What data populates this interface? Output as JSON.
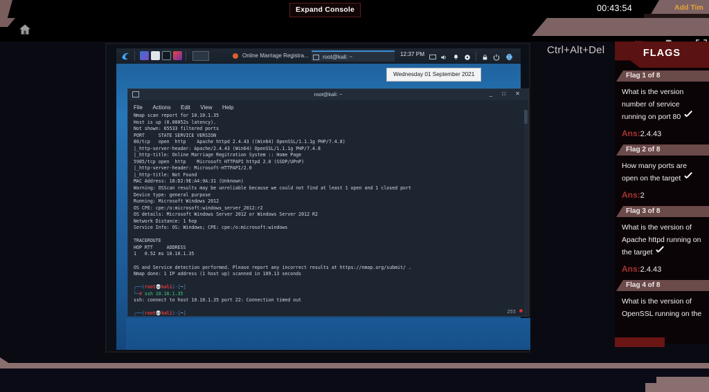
{
  "platform": {
    "expand_console_label": "Expand Console",
    "timer": "00:43:54",
    "add_time_label": "Add Tim",
    "ctrl_alt_del_label": "Ctrl+Alt+Del",
    "home_icon": "home-icon",
    "flag_icon": "red-flag-icon",
    "doc_icon": "document-icon",
    "fullscreen_icon": "fullscreen-icon",
    "accent_red": "#6b1515",
    "accent_orange": "#e8a33d",
    "chrome_brown": "#7d6363"
  },
  "flags_panel": {
    "title": "FLAGS",
    "answer_label": "Ans:",
    "flags": [
      {
        "header": "Flag 1 of 8",
        "question_lines": [
          "What is the version",
          "number of service",
          "running on port 80"
        ],
        "solved": true,
        "answer": "2.4.43"
      },
      {
        "header": "Flag 2 of 8",
        "question_lines": [
          "How many ports are",
          "open on the target"
        ],
        "solved": true,
        "answer": "2"
      },
      {
        "header": "Flag 3 of 8",
        "question_lines": [
          "What is the version of",
          "Apache httpd running on",
          "the target"
        ],
        "solved": true,
        "answer": "2.4.43"
      },
      {
        "header": "Flag 4 of 8",
        "question_lines": [
          "What is the version of",
          "OpenSSL running on the"
        ],
        "solved": false,
        "answer": ""
      }
    ]
  },
  "kali": {
    "taskbar": {
      "launcher_icon": "kali-dragon-icon",
      "quick_icons": [
        "terminal-icon",
        "files-icon",
        "console-icon",
        "firefox-icon"
      ],
      "active_app_icon": "terminal-icon",
      "windows": [
        {
          "title": "Online Marriage Registra...",
          "icon": "firefox-icon",
          "active": false
        },
        {
          "title": "root@kali: ~",
          "icon": "terminal-icon",
          "active": true
        }
      ],
      "clock": "12:37 PM",
      "tray_icons": [
        "display-icon",
        "volume-icon",
        "notification-bell-icon",
        "updates-icon",
        "lock-icon",
        "power-icon",
        "network-icon"
      ]
    },
    "date_tooltip": "Wednesday 01 September 2021",
    "terminal": {
      "title": "root@kali: ~",
      "menu": [
        "File",
        "Actions",
        "Edit",
        "View",
        "Help"
      ],
      "window_buttons": [
        "minimize",
        "maximize",
        "close"
      ],
      "exit_status": "255",
      "output": "Nmap scan report for 10.10.1.35\nHost is up (0.00052s latency).\nNot shown: 65533 filtered ports\nPORT     STATE SERVICE VERSION\n80/tcp   open  http    Apache httpd 2.4.43 ((Win64) OpenSSL/1.1.1g PHP/7.4.8)\n|_http-server-header: Apache/2.4.43 (Win64) OpenSSL/1.1.1g PHP/7.4.8\n|_http-title: Online Marriage Regitration System :: Home Page\n5985/tcp open  http    Microsoft HTTPAPI httpd 2.0 (SSDP/UPnP)\n|_http-server-header: Microsoft-HTTPAPI/2.0\n|_http-title: Not Found\nMAC Address: 18:D2:9E:A4:9A:31 (Unknown)\nWarning: OSScan results may be unreliable because we could not find at least 1 open and 1 closed port\nDevice type: general purpose\nRunning: Microsoft Windows 2012\nOS CPE: cpe:/o:microsoft:windows_server_2012:r2\nOS details: Microsoft Windows Server 2012 or Windows Server 2012 R2\nNetwork Distance: 1 hop\nService Info: OS: Windows; CPE: cpe:/o:microsoft:windows\n\nTRACEROUTE\nHOP RTT     ADDRESS\n1   0.52 ms 10.10.1.35\n\nOS and Service detection performed. Please report any incorrect results at https://nmap.org/submit/ .\nNmap done: 1 IP address (1 host up) scanned in 109.13 seconds\n",
      "prompt1_user": "root",
      "prompt1_host": "kali",
      "prompt1_path": "~",
      "command1": "ssh 10.10.1.35",
      "command1_result": "ssh: connect to host 10.10.1.35 port 22: Connection timed out",
      "prompt2_user": "root",
      "prompt2_host": "kali",
      "prompt2_path": "~"
    }
  }
}
